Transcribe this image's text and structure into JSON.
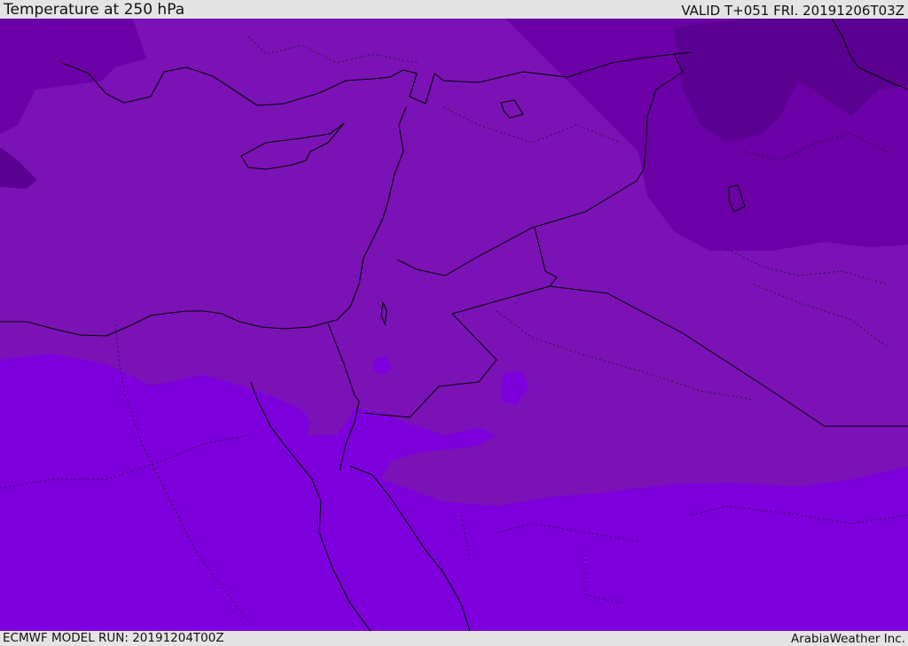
{
  "header": {
    "title": "Temperature at 250 hPa",
    "valid": "VALID T+051 FRI. 20191206T03Z"
  },
  "footer": {
    "model_run": "ECMWF MODEL RUN: 20191204T00Z",
    "credit": "ArabiaWeather Inc."
  },
  "map": {
    "region": "Eastern Mediterranean / Middle East",
    "variable": "temperature",
    "level": "250 hPa",
    "colors": {
      "coldest": "#5a0090",
      "colder": "#6a00a6",
      "base": "#7a12b6",
      "warm": "#7d00dc",
      "warm_blob": "#8a2ae6"
    }
  }
}
